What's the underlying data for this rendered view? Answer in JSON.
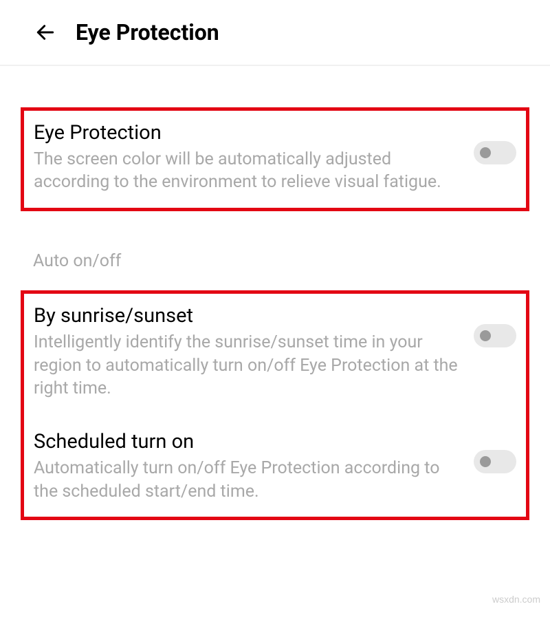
{
  "header": {
    "title": "Eye Protection"
  },
  "settings": {
    "eyeProtection": {
      "title": "Eye Protection",
      "description": "The screen color will be automatically adjusted according to the environment to relieve visual fatigue."
    },
    "sectionLabel": "Auto on/off",
    "sunriseSunset": {
      "title": "By sunrise/sunset",
      "description": "Intelligently identify the sunrise/sunset time in your region to automatically turn on/off Eye Protection at the right time."
    },
    "scheduled": {
      "title": "Scheduled turn on",
      "description": "Automatically turn on/off Eye Protection according to the scheduled start/end time."
    }
  },
  "watermark": "wsxdn.com"
}
